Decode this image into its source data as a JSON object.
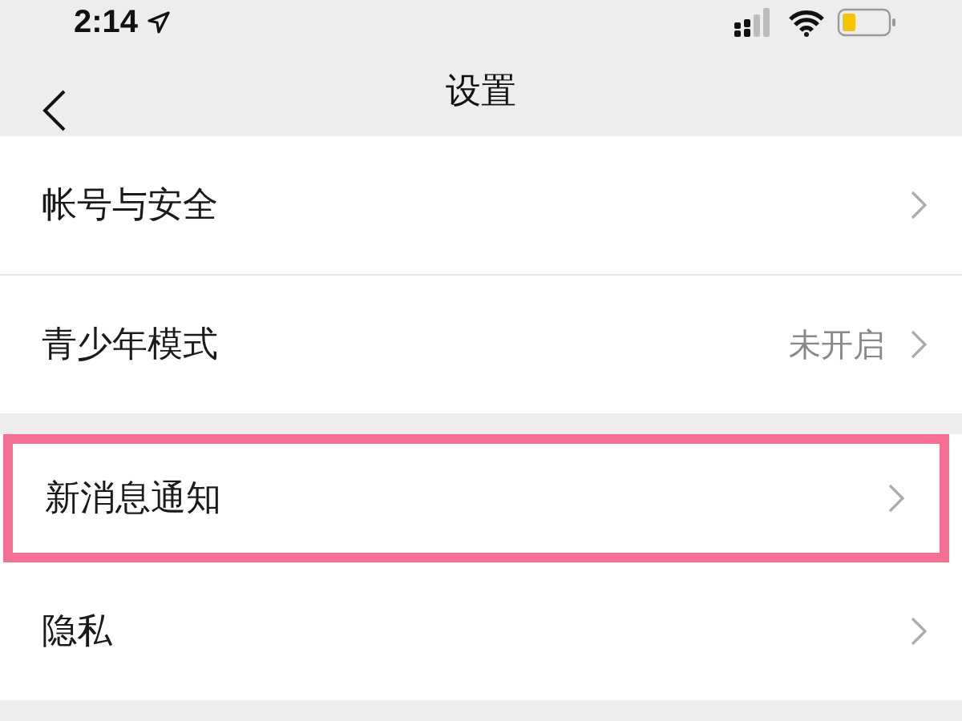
{
  "status_bar": {
    "time": "2:14"
  },
  "nav": {
    "title": "设置"
  },
  "groups": [
    {
      "items": [
        {
          "label": "帐号与安全",
          "highlighted": false
        },
        {
          "label": "青少年模式",
          "value": "未开启",
          "highlighted": false
        }
      ]
    },
    {
      "items": [
        {
          "label": "新消息通知",
          "highlighted": true
        },
        {
          "label": "隐私",
          "highlighted": false
        }
      ]
    }
  ]
}
